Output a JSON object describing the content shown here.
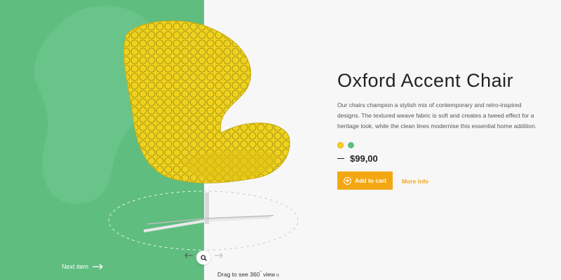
{
  "product": {
    "title": "Oxford Accent Chair",
    "description": "Our chairs champion a stylish mix of contemporary and retro-inspired designs. The textured weave fabric is soft and creates a tweed effect for a heritage look, while the clean lines modernise this essential home addition.",
    "price": "$99,00",
    "colors": [
      {
        "name": "yellow",
        "hex": "#f3d41a",
        "selected": true
      },
      {
        "name": "green",
        "hex": "#5fbd80",
        "selected": false
      }
    ]
  },
  "actions": {
    "add_to_cart": "Add to cart",
    "more_info": "More info"
  },
  "nav": {
    "next_item": "Next item"
  },
  "viewer": {
    "drag_hint": "Drag to see 360",
    "drag_hint_deg": "°",
    "drag_hint_suffix": " view"
  },
  "theme": {
    "accent": "#f3a712",
    "left_bg": "#5fbd80",
    "right_bg": "#f7f7f7"
  },
  "icons": {
    "add": "plus-circle-icon",
    "next": "arrow-right-icon",
    "rotate_left": "arrow-left-icon",
    "rotate_right": "arrow-right-icon",
    "zoom": "search-icon"
  }
}
